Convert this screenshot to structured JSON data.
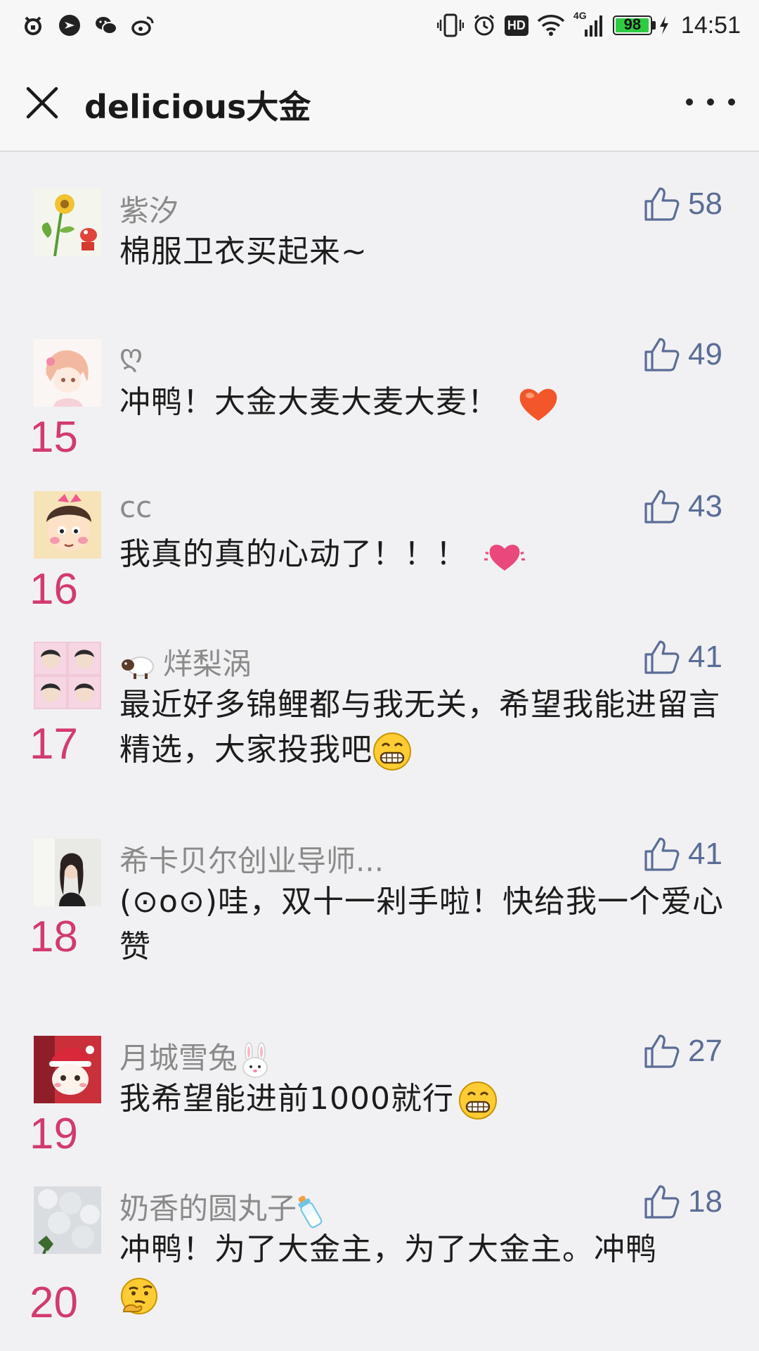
{
  "status_bar": {
    "time": "14:51",
    "battery": "98",
    "network": "4G",
    "hd": "HD"
  },
  "nav": {
    "title": "delicious大金"
  },
  "comments": [
    {
      "rank": "",
      "name": "紫汐",
      "text": "棉服卫衣买起来~",
      "likes": "58"
    },
    {
      "rank": "15",
      "name": "ღ",
      "text": "冲鸭！大金大麦大麦大麦！",
      "likes": "49"
    },
    {
      "rank": "16",
      "name": "cc",
      "text": "我真的真的心动了！！！",
      "likes": "43"
    },
    {
      "rank": "17",
      "name": "烊梨涡",
      "text": "最近好多锦鲤都与我无关，希望我能进留言精选，大家投我吧",
      "likes": "41"
    },
    {
      "rank": "18",
      "name": "希卡贝尔创业导师...",
      "text": "(⊙o⊙)哇，双十一剁手啦！快给我一个爱心赞",
      "likes": "41"
    },
    {
      "rank": "19",
      "name": "月城雪兔",
      "text": "我希望能进前1000就行",
      "likes": "27"
    },
    {
      "rank": "20",
      "name": "奶香的圆丸子",
      "text": "冲鸭！为了大金主，为了大金主。冲鸭",
      "likes": "18"
    }
  ],
  "colors": {
    "rank": "#d23a71",
    "like": "#5a6d96",
    "background": "#f1f1f3"
  }
}
